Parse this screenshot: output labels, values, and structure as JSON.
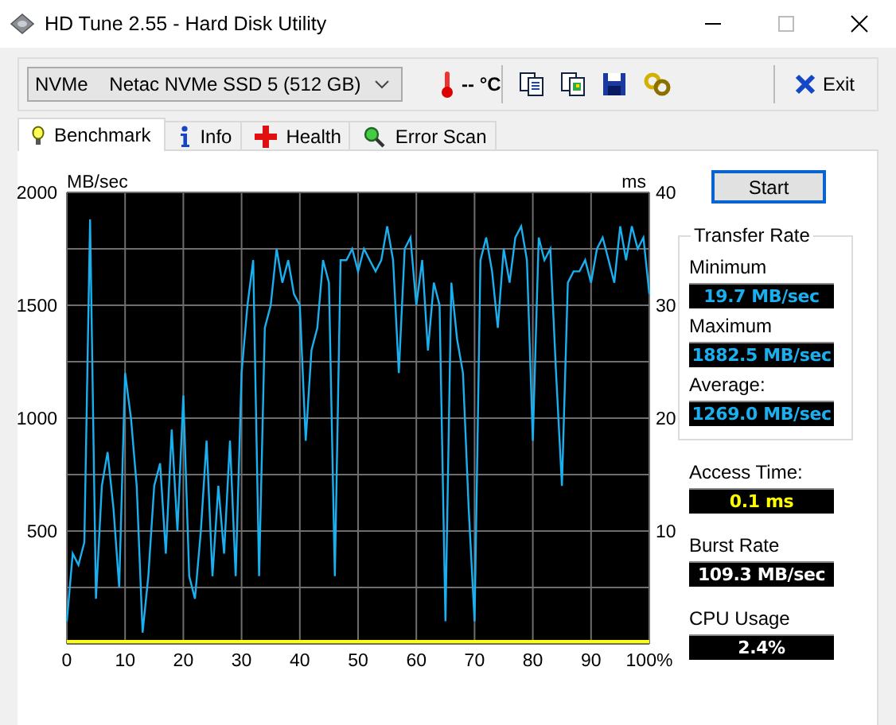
{
  "window": {
    "title": "HD Tune 2.55 - Hard Disk Utility"
  },
  "toolbar": {
    "drive": "NVMe    Netac NVMe SSD 5 (512 GB)",
    "temperature": "-- °C",
    "exit": "Exit"
  },
  "tabs": [
    {
      "label": "Benchmark",
      "selected": true
    },
    {
      "label": "Info",
      "selected": false
    },
    {
      "label": "Health",
      "selected": false
    },
    {
      "label": "Error Scan",
      "selected": false
    }
  ],
  "start_button": "Start",
  "chart": {
    "left_unit": "MB/sec",
    "right_unit": "ms",
    "right_ticks": [
      "40",
      "30",
      "20",
      "10"
    ],
    "chart_data": {
      "type": "line",
      "grid": true,
      "ylim": [
        0,
        2000
      ],
      "xlim": [
        0,
        100
      ],
      "yticks": [
        500,
        1000,
        1500,
        2000
      ],
      "xticks": [
        0,
        10,
        20,
        30,
        40,
        50,
        60,
        70,
        80,
        90,
        {
          "value": 100,
          "label": "100%"
        }
      ],
      "x": [
        0,
        1,
        2,
        3,
        4,
        5,
        6,
        7,
        8,
        9,
        10,
        11,
        12,
        13,
        14,
        15,
        16,
        17,
        18,
        19,
        20,
        21,
        22,
        23,
        24,
        25,
        26,
        27,
        28,
        29,
        30,
        31,
        32,
        33,
        34,
        35,
        36,
        37,
        38,
        39,
        40,
        41,
        42,
        43,
        44,
        45,
        46,
        47,
        48,
        49,
        50,
        51,
        52,
        53,
        54,
        55,
        56,
        57,
        58,
        59,
        60,
        61,
        62,
        63,
        64,
        65,
        66,
        67,
        68,
        69,
        70,
        71,
        72,
        73,
        74,
        75,
        76,
        77,
        78,
        79,
        80,
        81,
        82,
        83,
        84,
        85,
        86,
        87,
        88,
        89,
        90,
        91,
        92,
        93,
        94,
        95,
        96,
        97,
        98,
        99,
        100
      ],
      "series": [
        {
          "color": "#1ab0f0",
          "values": [
            100,
            400,
            350,
            450,
            1880,
            200,
            700,
            850,
            600,
            250,
            1200,
            1000,
            700,
            50,
            300,
            700,
            800,
            400,
            950,
            500,
            1100,
            300,
            200,
            500,
            900,
            300,
            700,
            400,
            900,
            300,
            1200,
            1500,
            1700,
            300,
            1400,
            1500,
            1750,
            1600,
            1700,
            1550,
            1500,
            900,
            1300,
            1400,
            1700,
            1600,
            300,
            1700,
            1700,
            1750,
            1650,
            1750,
            1700,
            1650,
            1700,
            1850,
            1700,
            1200,
            1750,
            1800,
            1500,
            1700,
            1300,
            1600,
            1500,
            100,
            1600,
            1350,
            1200,
            600,
            100,
            1700,
            1800,
            1650,
            1400,
            1750,
            1600,
            1800,
            1850,
            1700,
            900,
            1800,
            1700,
            1750,
            1200,
            700,
            1600,
            1650,
            1650,
            1700,
            1600,
            1750,
            1800,
            1700,
            1600,
            1850,
            1700,
            1850,
            1750,
            1800,
            1550
          ]
        }
      ]
    }
  },
  "transfer_rate": {
    "title": "Transfer Rate",
    "items": [
      {
        "label": "Minimum",
        "value": "19.7 MB/sec"
      },
      {
        "label": "Maximum",
        "value": "1882.5 MB/sec"
      },
      {
        "label": "Average:",
        "value": "1269.0 MB/sec"
      }
    ]
  },
  "stats": [
    {
      "label": "Access Time:",
      "value": "0.1 ms"
    },
    {
      "label": "Burst Rate",
      "value": "109.3 MB/sec"
    },
    {
      "label": "CPU Usage",
      "value": "2.4%"
    }
  ]
}
